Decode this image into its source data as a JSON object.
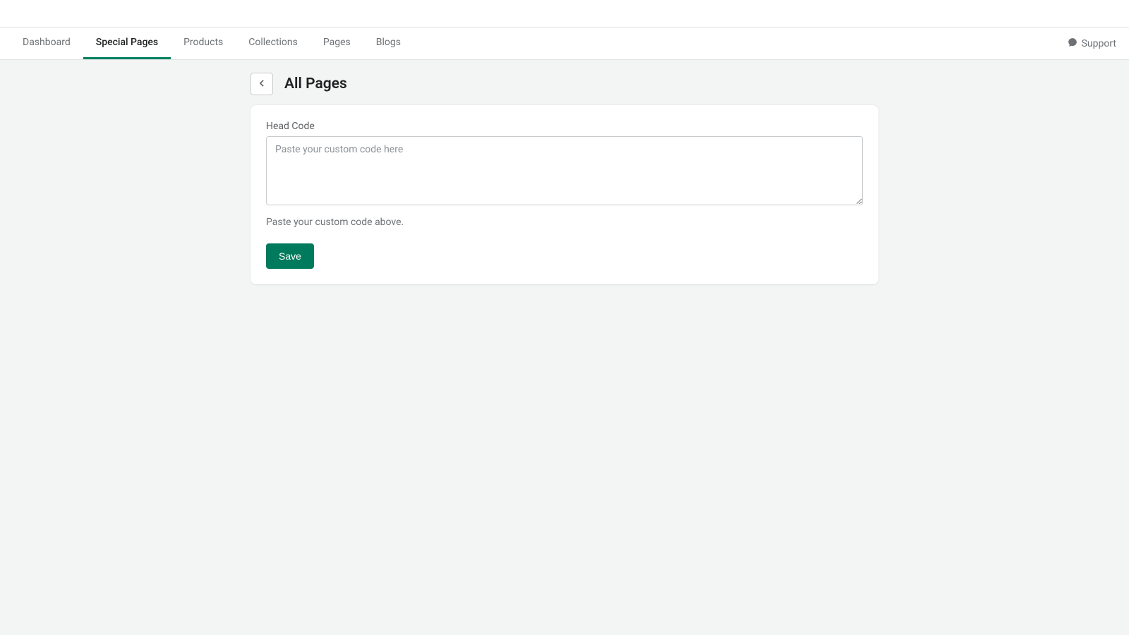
{
  "nav": {
    "tabs": [
      {
        "label": "Dashboard",
        "active": false
      },
      {
        "label": "Special Pages",
        "active": true
      },
      {
        "label": "Products",
        "active": false
      },
      {
        "label": "Collections",
        "active": false
      },
      {
        "label": "Pages",
        "active": false
      },
      {
        "label": "Blogs",
        "active": false
      }
    ],
    "support_label": "Support"
  },
  "page": {
    "title": "All Pages"
  },
  "form": {
    "head_code_label": "Head Code",
    "head_code_placeholder": "Paste your custom code here",
    "head_code_value": "",
    "head_code_helper": "Paste your custom code above.",
    "save_label": "Save"
  },
  "colors": {
    "accent": "#008060",
    "save_button": "#007a5c"
  }
}
